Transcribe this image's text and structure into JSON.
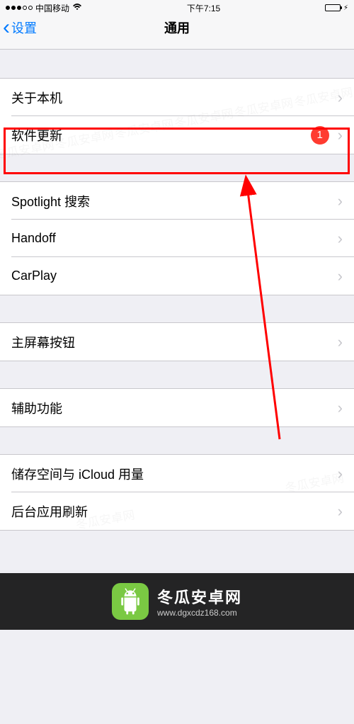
{
  "status": {
    "carrier": "中国移动",
    "time": "下午7:15"
  },
  "nav": {
    "back": "设置",
    "title": "通用"
  },
  "rows": {
    "about": "关于本机",
    "software_update": "软件更新",
    "software_update_badge": "1",
    "spotlight": "Spotlight 搜索",
    "handoff": "Handoff",
    "carplay": "CarPlay",
    "home_button": "主屏幕按钮",
    "accessibility": "辅助功能",
    "storage": "储存空间与 iCloud 用量",
    "background_refresh": "后台应用刷新"
  },
  "watermark": {
    "title": "冬瓜安卓网",
    "url": "www.dgxcdz168.com"
  }
}
